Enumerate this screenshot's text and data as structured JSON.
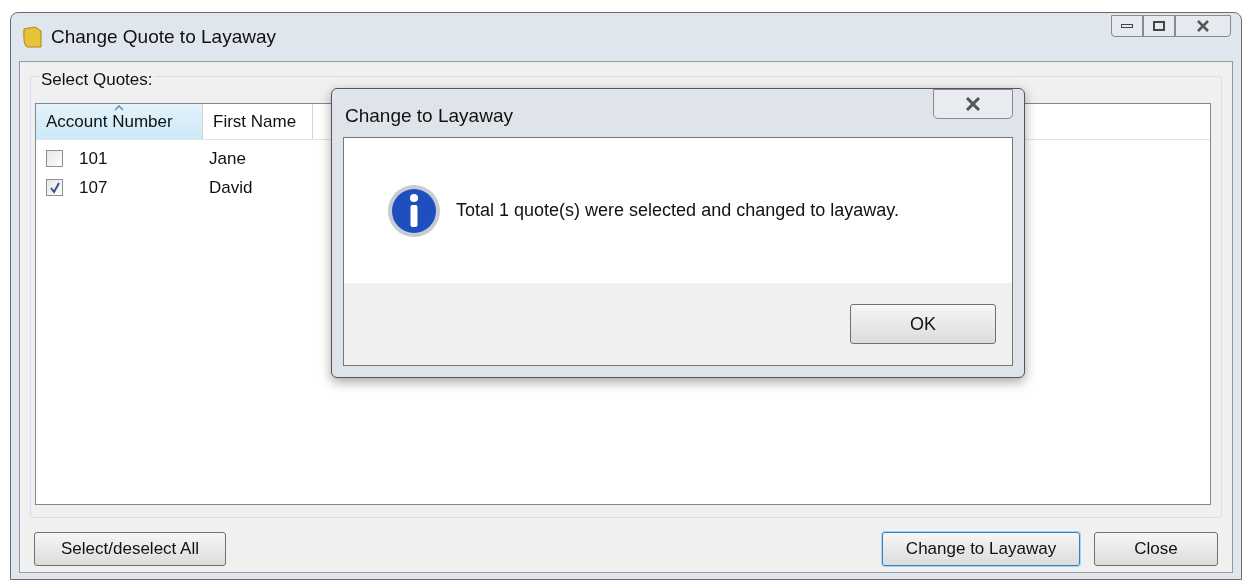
{
  "window": {
    "title": "Change Quote to Layaway"
  },
  "group": {
    "label": "Select Quotes:"
  },
  "table": {
    "columns": [
      {
        "label": "Account Number",
        "sorted": true
      },
      {
        "label": "First Name",
        "sorted": false
      }
    ],
    "rows": [
      {
        "checked": false,
        "cells": [
          "101",
          "Jane"
        ]
      },
      {
        "checked": true,
        "cells": [
          "107",
          "David"
        ]
      }
    ]
  },
  "buttons": [
    {
      "label": "Select/deselect All",
      "default": false
    },
    {
      "label": "Change to Layaway",
      "default": true
    },
    {
      "label": "Close",
      "default": false
    }
  ],
  "dialog": {
    "title": "Change to Layaway",
    "message": "Total 1 quote(s) were selected and changed to layaway.",
    "button": "OK"
  }
}
